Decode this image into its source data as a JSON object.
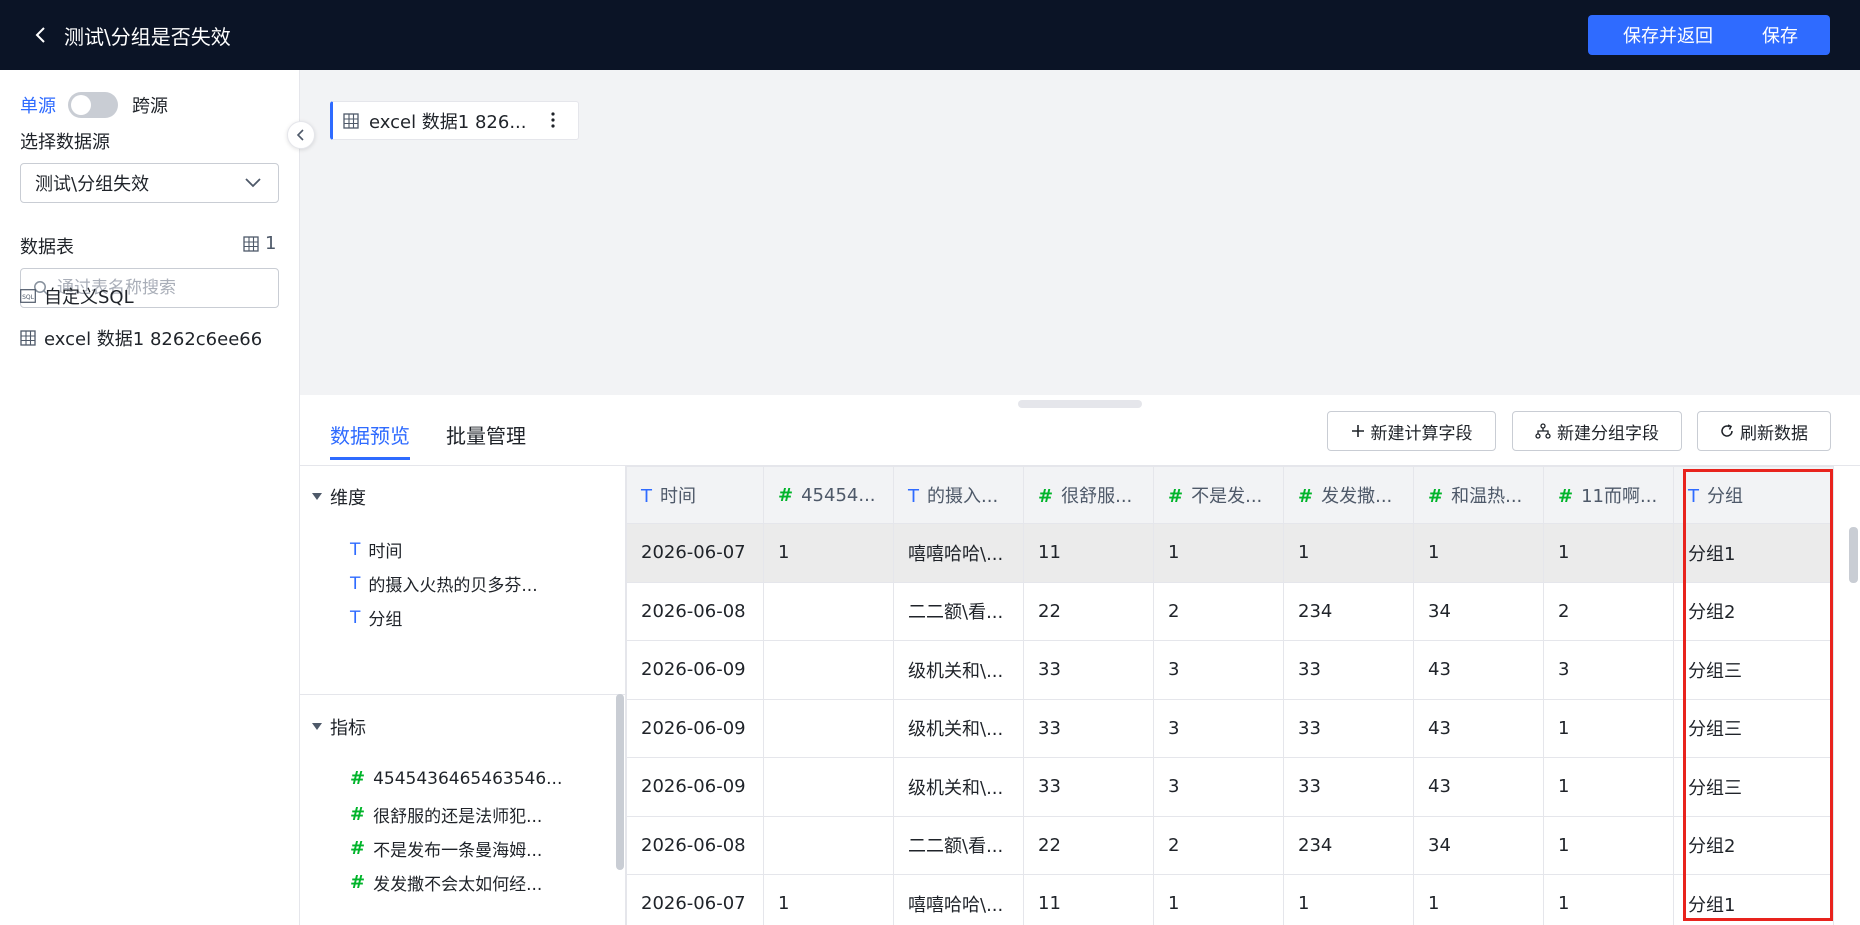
{
  "header": {
    "title": "测试\\分组是否失效",
    "save_return_label": "保存并返回",
    "save_label": "保存"
  },
  "sidebar": {
    "mode_single": "单源",
    "mode_cross": "跨源",
    "datasource_label": "选择数据源",
    "datasource_value": "测试\\分组失效",
    "tables_label": "数据表",
    "tables_count": "1",
    "search_placeholder": "通过表名称搜索",
    "items": [
      {
        "label": "自定义SQL"
      },
      {
        "label": "excel 数据1 8262c6ee66"
      }
    ]
  },
  "canvas": {
    "table_card_label": "excel 数据1 826..."
  },
  "tabs": [
    {
      "label": "数据预览"
    },
    {
      "label": "批量管理"
    }
  ],
  "toolbar": {
    "new_calc_field": "新建计算字段",
    "new_group_field": "新建分组字段",
    "refresh": "刷新数据"
  },
  "fields": {
    "dimension_title": "维度",
    "dimensions": [
      "时间",
      "的摄入火热的贝多芬...",
      "分组"
    ],
    "measure_title": "指标",
    "measures": [
      "4545436465463546...",
      "很舒服的还是法师犯...",
      "不是发布一条曼海姆...",
      "发发撒不会太如何经..."
    ]
  },
  "table": {
    "columns": [
      {
        "type": "T",
        "label": "时间"
      },
      {
        "type": "#",
        "label": "45454..."
      },
      {
        "type": "T",
        "label": "的摄入..."
      },
      {
        "type": "#",
        "label": "很舒服..."
      },
      {
        "type": "#",
        "label": "不是发..."
      },
      {
        "type": "#",
        "label": "发发撒..."
      },
      {
        "type": "#",
        "label": "和温热..."
      },
      {
        "type": "#",
        "label": "11而啊..."
      },
      {
        "type": "T",
        "label": "分组"
      }
    ],
    "rows": [
      [
        "2026-06-07",
        "1",
        "嘻嘻哈哈\\...",
        "11",
        "1",
        "1",
        "1",
        "1",
        "分组1"
      ],
      [
        "2026-06-08",
        "",
        "二二额\\看...",
        "22",
        "2",
        "234",
        "34",
        "2",
        "分组2"
      ],
      [
        "2026-06-09",
        "",
        "级机关和\\...",
        "33",
        "3",
        "33",
        "43",
        "3",
        "分组三"
      ],
      [
        "2026-06-09",
        "",
        "级机关和\\...",
        "33",
        "3",
        "33",
        "43",
        "1",
        "分组三"
      ],
      [
        "2026-06-09",
        "",
        "级机关和\\...",
        "33",
        "3",
        "33",
        "43",
        "1",
        "分组三"
      ],
      [
        "2026-06-08",
        "",
        "二二额\\看...",
        "22",
        "2",
        "234",
        "34",
        "1",
        "分组2"
      ],
      [
        "2026-06-07",
        "1",
        "嘻嘻哈哈\\...",
        "11",
        "1",
        "1",
        "1",
        "1",
        "分组1"
      ]
    ]
  },
  "colors": {
    "accent": "#2f6bff",
    "header_bg": "#0b1426",
    "measure_icon": "#00b42a",
    "highlight_border": "#e8231d"
  }
}
